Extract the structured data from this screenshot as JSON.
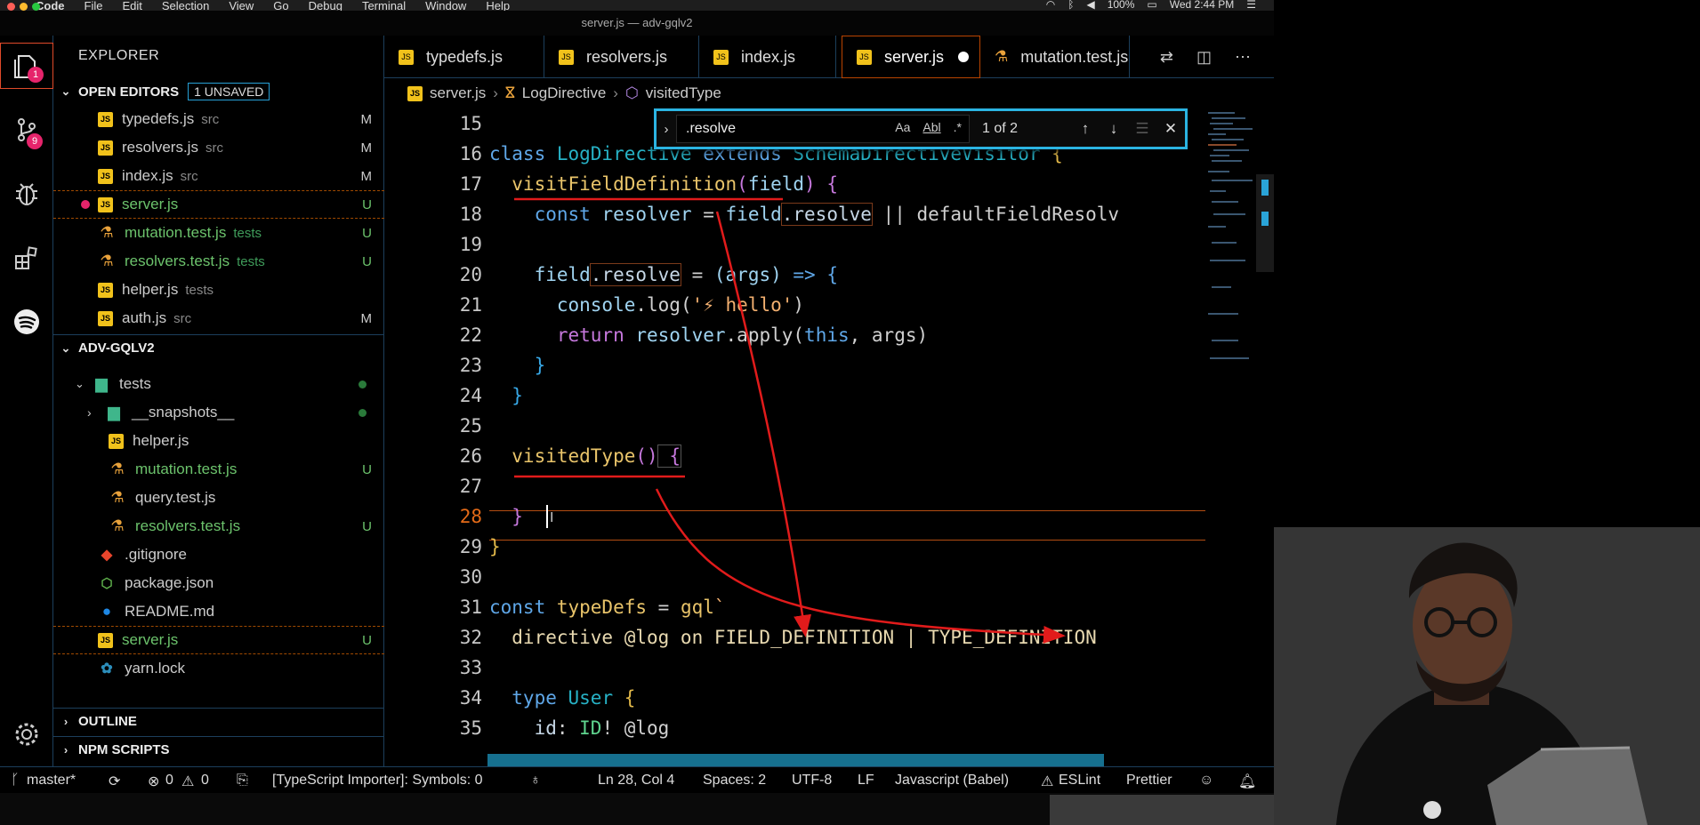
{
  "menubar": {
    "items": [
      "Code",
      "File",
      "Edit",
      "Selection",
      "View",
      "Go",
      "Debug",
      "Terminal",
      "Window",
      "Help"
    ],
    "battery": "100%",
    "clock": "Wed 2:44 PM"
  },
  "window": {
    "title": "server.js — adv-gqlv2"
  },
  "activity_bar": {
    "explorer_badge": "1",
    "scm_badge": "9",
    "icons": [
      "files-icon",
      "source-control-icon",
      "debug-icon",
      "extensions-icon",
      "spotify-icon",
      "gear-icon"
    ]
  },
  "sidebar": {
    "title": "EXPLORER",
    "open_editors": {
      "label": "OPEN EDITORS",
      "unsaved_badge": "1 UNSAVED",
      "items": [
        {
          "name": "typedefs.js",
          "dir": "src",
          "status": "M",
          "kind": "js"
        },
        {
          "name": "resolvers.js",
          "dir": "src",
          "status": "M",
          "kind": "js"
        },
        {
          "name": "index.js",
          "dir": "src",
          "status": "M",
          "kind": "js"
        },
        {
          "name": "server.js",
          "dir": "",
          "status": "U",
          "kind": "js"
        },
        {
          "name": "mutation.test.js",
          "dir": "tests",
          "status": "U",
          "kind": "test"
        },
        {
          "name": "resolvers.test.js",
          "dir": "tests",
          "status": "U",
          "kind": "test"
        },
        {
          "name": "helper.js",
          "dir": "tests",
          "status": "",
          "kind": "js"
        },
        {
          "name": "auth.js",
          "dir": "src",
          "status": "M",
          "kind": "js"
        }
      ]
    },
    "project": {
      "label": "ADV-GQLV2",
      "items": [
        {
          "name": "tests",
          "status": "",
          "kind": "folder"
        },
        {
          "name": "__snapshots__",
          "status": "",
          "kind": "folder"
        },
        {
          "name": "helper.js",
          "status": "",
          "kind": "js"
        },
        {
          "name": "mutation.test.js",
          "status": "U",
          "kind": "test"
        },
        {
          "name": "query.test.js",
          "status": "",
          "kind": "test"
        },
        {
          "name": "resolvers.test.js",
          "status": "U",
          "kind": "test"
        },
        {
          "name": ".gitignore",
          "status": "",
          "kind": "git"
        },
        {
          "name": "package.json",
          "status": "",
          "kind": "npm"
        },
        {
          "name": "README.md",
          "status": "",
          "kind": "info"
        },
        {
          "name": "server.js",
          "status": "U",
          "kind": "js"
        },
        {
          "name": "yarn.lock",
          "status": "",
          "kind": "yarn"
        }
      ]
    },
    "outline_label": "OUTLINE",
    "npm_label": "NPM SCRIPTS"
  },
  "tabs": [
    {
      "label": "typedefs.js",
      "kind": "js"
    },
    {
      "label": "resolvers.js",
      "kind": "js"
    },
    {
      "label": "index.js",
      "kind": "js"
    },
    {
      "label": "server.js",
      "kind": "js",
      "active": true
    },
    {
      "label": "mutation.test.js",
      "kind": "test"
    }
  ],
  "breadcrumb": [
    "server.js",
    "LogDirective",
    "visitedType"
  ],
  "find_widget": {
    "query": ".resolve",
    "count": "1 of 2",
    "options": [
      "Aa",
      "Abl",
      ".*"
    ]
  },
  "editor": {
    "current_line": "28",
    "line_numbers": [
      "15",
      "16",
      "17",
      "18",
      "19",
      "20",
      "21",
      "22",
      "23",
      "24",
      "25",
      "26",
      "27",
      "28",
      "29",
      "30",
      "31",
      "32",
      "33",
      "34",
      "35"
    ],
    "lines": {
      "l15": "",
      "l16a": "class ",
      "l16b": "LogDirective",
      "l16c": " extends ",
      "l16d": "SchemaDirectiveVisitor",
      "l16e": " {",
      "l17a": "  visitFieldDefinition",
      "l17b": "(",
      "l17c": "field",
      "l17d": ") {",
      "l18a": "    const ",
      "l18b": "resolver",
      "l18c": " = ",
      "l18d": "field",
      "l18e": ".resolve",
      "l18f": " || defaultFieldResolv",
      "l20a": "    field",
      "l20b": ".resolve",
      "l20c": " = ",
      "l20d": "(args)",
      "l20e": " => {",
      "l21a": "      console",
      "l21b": ".log(",
      "l21c": "'⚡ hello'",
      "l21d": ")",
      "l22a": "      return ",
      "l22b": "resolver",
      "l22c": ".apply(",
      "l22d": "this",
      "l22e": ", args)",
      "l23": "    }",
      "l24": "  }",
      "l26a": "  visitedType",
      "l26b": "()",
      "l26c": " {",
      "l28": "  }",
      "l29": "}",
      "l31a": "const ",
      "l31b": "typeDefs",
      "l31c": " = ",
      "l31d": "gql",
      "l31e": "`",
      "l32": "  directive @log on FIELD_DEFINITION | TYPE_DEFINITION",
      "l34a": "  type ",
      "l34b": "User",
      "l34c": " {",
      "l35a": "    id",
      "l35b": ": ",
      "l35c": "ID",
      "l35d": "! @log"
    }
  },
  "status_bar": {
    "branch": "master*",
    "problems": "0",
    "warnings": "0",
    "importer": "[TypeScript Importer]: Symbols: 0",
    "position": "Ln 28, Col 4",
    "spaces": "Spaces: 2",
    "encoding": "UTF-8",
    "eol": "LF",
    "language": "Javascript (Babel)",
    "eslint": "ESLint",
    "prettier": "Prettier"
  },
  "colors": {
    "accent": "#27a0d6",
    "modified_tab_border": "#b94400",
    "annotation": "#e11b1b",
    "badge": "#e6246b"
  }
}
